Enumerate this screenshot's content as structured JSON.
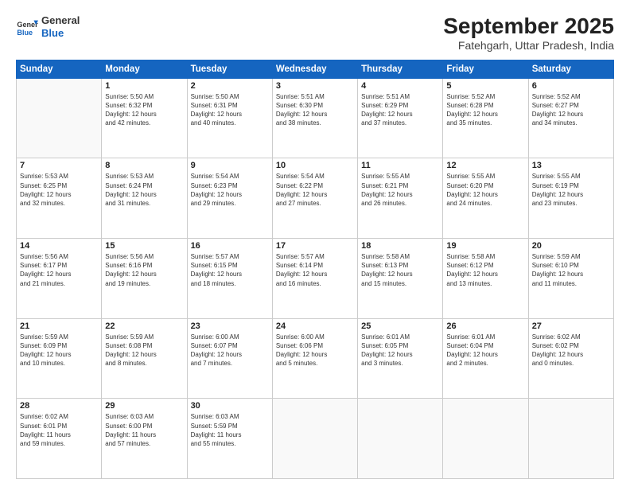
{
  "header": {
    "logo_line1": "General",
    "logo_line2": "Blue",
    "month": "September 2025",
    "location": "Fatehgarh, Uttar Pradesh, India"
  },
  "weekdays": [
    "Sunday",
    "Monday",
    "Tuesday",
    "Wednesday",
    "Thursday",
    "Friday",
    "Saturday"
  ],
  "weeks": [
    [
      {
        "day": "",
        "info": ""
      },
      {
        "day": "1",
        "info": "Sunrise: 5:50 AM\nSunset: 6:32 PM\nDaylight: 12 hours\nand 42 minutes."
      },
      {
        "day": "2",
        "info": "Sunrise: 5:50 AM\nSunset: 6:31 PM\nDaylight: 12 hours\nand 40 minutes."
      },
      {
        "day": "3",
        "info": "Sunrise: 5:51 AM\nSunset: 6:30 PM\nDaylight: 12 hours\nand 38 minutes."
      },
      {
        "day": "4",
        "info": "Sunrise: 5:51 AM\nSunset: 6:29 PM\nDaylight: 12 hours\nand 37 minutes."
      },
      {
        "day": "5",
        "info": "Sunrise: 5:52 AM\nSunset: 6:28 PM\nDaylight: 12 hours\nand 35 minutes."
      },
      {
        "day": "6",
        "info": "Sunrise: 5:52 AM\nSunset: 6:27 PM\nDaylight: 12 hours\nand 34 minutes."
      }
    ],
    [
      {
        "day": "7",
        "info": "Sunrise: 5:53 AM\nSunset: 6:25 PM\nDaylight: 12 hours\nand 32 minutes."
      },
      {
        "day": "8",
        "info": "Sunrise: 5:53 AM\nSunset: 6:24 PM\nDaylight: 12 hours\nand 31 minutes."
      },
      {
        "day": "9",
        "info": "Sunrise: 5:54 AM\nSunset: 6:23 PM\nDaylight: 12 hours\nand 29 minutes."
      },
      {
        "day": "10",
        "info": "Sunrise: 5:54 AM\nSunset: 6:22 PM\nDaylight: 12 hours\nand 27 minutes."
      },
      {
        "day": "11",
        "info": "Sunrise: 5:55 AM\nSunset: 6:21 PM\nDaylight: 12 hours\nand 26 minutes."
      },
      {
        "day": "12",
        "info": "Sunrise: 5:55 AM\nSunset: 6:20 PM\nDaylight: 12 hours\nand 24 minutes."
      },
      {
        "day": "13",
        "info": "Sunrise: 5:55 AM\nSunset: 6:19 PM\nDaylight: 12 hours\nand 23 minutes."
      }
    ],
    [
      {
        "day": "14",
        "info": "Sunrise: 5:56 AM\nSunset: 6:17 PM\nDaylight: 12 hours\nand 21 minutes."
      },
      {
        "day": "15",
        "info": "Sunrise: 5:56 AM\nSunset: 6:16 PM\nDaylight: 12 hours\nand 19 minutes."
      },
      {
        "day": "16",
        "info": "Sunrise: 5:57 AM\nSunset: 6:15 PM\nDaylight: 12 hours\nand 18 minutes."
      },
      {
        "day": "17",
        "info": "Sunrise: 5:57 AM\nSunset: 6:14 PM\nDaylight: 12 hours\nand 16 minutes."
      },
      {
        "day": "18",
        "info": "Sunrise: 5:58 AM\nSunset: 6:13 PM\nDaylight: 12 hours\nand 15 minutes."
      },
      {
        "day": "19",
        "info": "Sunrise: 5:58 AM\nSunset: 6:12 PM\nDaylight: 12 hours\nand 13 minutes."
      },
      {
        "day": "20",
        "info": "Sunrise: 5:59 AM\nSunset: 6:10 PM\nDaylight: 12 hours\nand 11 minutes."
      }
    ],
    [
      {
        "day": "21",
        "info": "Sunrise: 5:59 AM\nSunset: 6:09 PM\nDaylight: 12 hours\nand 10 minutes."
      },
      {
        "day": "22",
        "info": "Sunrise: 5:59 AM\nSunset: 6:08 PM\nDaylight: 12 hours\nand 8 minutes."
      },
      {
        "day": "23",
        "info": "Sunrise: 6:00 AM\nSunset: 6:07 PM\nDaylight: 12 hours\nand 7 minutes."
      },
      {
        "day": "24",
        "info": "Sunrise: 6:00 AM\nSunset: 6:06 PM\nDaylight: 12 hours\nand 5 minutes."
      },
      {
        "day": "25",
        "info": "Sunrise: 6:01 AM\nSunset: 6:05 PM\nDaylight: 12 hours\nand 3 minutes."
      },
      {
        "day": "26",
        "info": "Sunrise: 6:01 AM\nSunset: 6:04 PM\nDaylight: 12 hours\nand 2 minutes."
      },
      {
        "day": "27",
        "info": "Sunrise: 6:02 AM\nSunset: 6:02 PM\nDaylight: 12 hours\nand 0 minutes."
      }
    ],
    [
      {
        "day": "28",
        "info": "Sunrise: 6:02 AM\nSunset: 6:01 PM\nDaylight: 11 hours\nand 59 minutes."
      },
      {
        "day": "29",
        "info": "Sunrise: 6:03 AM\nSunset: 6:00 PM\nDaylight: 11 hours\nand 57 minutes."
      },
      {
        "day": "30",
        "info": "Sunrise: 6:03 AM\nSunset: 5:59 PM\nDaylight: 11 hours\nand 55 minutes."
      },
      {
        "day": "",
        "info": ""
      },
      {
        "day": "",
        "info": ""
      },
      {
        "day": "",
        "info": ""
      },
      {
        "day": "",
        "info": ""
      }
    ]
  ]
}
